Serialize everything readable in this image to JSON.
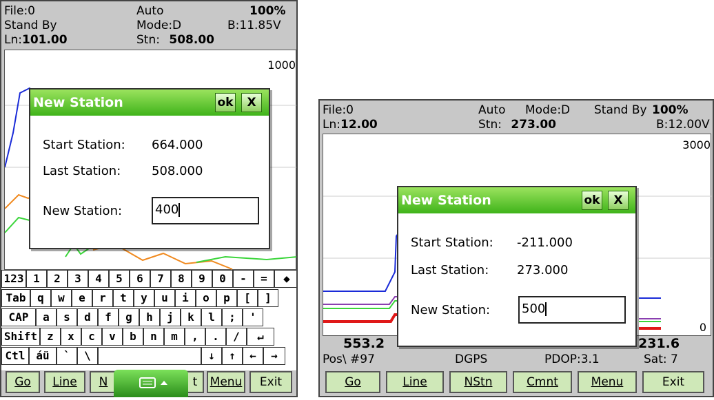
{
  "colors": {
    "accent": "#3fb31a",
    "series_blue": "#1a2bd8",
    "series_orange": "#f08a20",
    "series_green": "#3ad53a",
    "series_red": "#e01818",
    "series_purple": "#8a3fb0"
  },
  "left": {
    "status": {
      "file": "File:0",
      "mode_top": "Auto",
      "battery_pct": "100%",
      "state": "Stand By",
      "mode": "Mode:D",
      "battery_v": "B:11.85V",
      "line_label": "Ln:",
      "line_value": "101.00",
      "station_label": "Stn:",
      "station_value": "508.00"
    },
    "scale_max": "1000",
    "dialog": {
      "title": "New Station",
      "ok": "ok",
      "close": "X",
      "start_label": "Start Station:",
      "start_value": "664.000",
      "last_label": "Last Station:",
      "last_value": "508.000",
      "new_label": "New Station:",
      "new_value": "400"
    },
    "keyboard": {
      "row1": [
        "123",
        "1",
        "2",
        "3",
        "4",
        "5",
        "6",
        "7",
        "8",
        "9",
        "0",
        "-",
        "=",
        "◆"
      ],
      "row2": [
        "Tab",
        "q",
        "w",
        "e",
        "r",
        "t",
        "y",
        "u",
        "i",
        "o",
        "p",
        "[",
        "]"
      ],
      "row3": [
        "CAP",
        "a",
        "s",
        "d",
        "f",
        "g",
        "h",
        "j",
        "k",
        "l",
        ";",
        "'"
      ],
      "row4": [
        "Shift",
        "z",
        "x",
        "c",
        "v",
        "b",
        "n",
        "m",
        ",",
        ".",
        "/",
        "↵"
      ],
      "row5": [
        "Ctl",
        "áü",
        "`",
        "\\",
        "",
        "↓",
        "↑",
        "←",
        "→"
      ]
    },
    "menu": {
      "go": "Go",
      "line": "Line",
      "nstn_partial": "N",
      "cmnt_partial": "t",
      "menu": "Menu",
      "exit": "Exit"
    },
    "sip_icon": "keyboard-icon"
  },
  "right": {
    "status": {
      "file": "File:0",
      "mode_top": "Auto",
      "mode": "Mode:D",
      "state": "Stand By",
      "battery_pct": "100%",
      "line_label": "Ln:",
      "line_value": "12.00",
      "station_label": "Stn:",
      "station_value": "273.00",
      "battery_v": "B:12.00V"
    },
    "scale_max": "3000",
    "scale_min": "0",
    "dialog": {
      "title": "New Station",
      "ok": "ok",
      "close": "X",
      "start_label": "Start Station:",
      "start_value": "-211.000",
      "last_label": "Last Station:",
      "last_value": "273.000",
      "new_label": "New Station:",
      "new_value": "500"
    },
    "readouts": {
      "v1": "553.2",
      "v4": "231.6"
    },
    "footer": {
      "pos": "Pos\\ #97",
      "fix": "DGPS",
      "pdop": "PDOP:3.1",
      "sat": "Sat: 7"
    },
    "menu": {
      "go": "Go",
      "line": "Line",
      "nstn": "NStn",
      "cmnt": "Cmnt",
      "menu": "Menu",
      "exit": "Exit"
    }
  }
}
